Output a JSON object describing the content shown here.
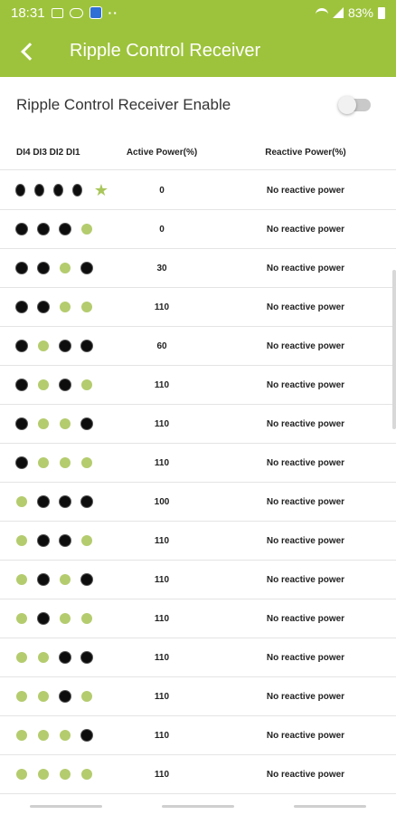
{
  "status_bar": {
    "time": "18:31",
    "dots": "··",
    "battery_text": "83%",
    "icons": [
      "image-icon",
      "wifi-icon",
      "app-icon",
      "wifi-signal-icon",
      "cell-signal-icon",
      "battery-icon"
    ]
  },
  "app_bar": {
    "back_icon": "chevron-left-icon",
    "title": "Ripple Control Receiver"
  },
  "enable": {
    "label": "Ripple Control Receiver Enable",
    "toggle_on": false
  },
  "table": {
    "headers": {
      "di": "DI4 DI3 DI2 DI1",
      "active": "Active Power(%)",
      "reactive": "Reactive Power(%)"
    },
    "rows": [
      {
        "di": [
          "on",
          "on",
          "on",
          "on"
        ],
        "starred": true,
        "active": "0",
        "reactive": "No reactive power"
      },
      {
        "di": [
          "on",
          "on",
          "on",
          "off"
        ],
        "starred": false,
        "active": "0",
        "reactive": "No reactive power"
      },
      {
        "di": [
          "on",
          "on",
          "off",
          "on"
        ],
        "starred": false,
        "active": "30",
        "reactive": "No reactive power"
      },
      {
        "di": [
          "on",
          "on",
          "off",
          "off"
        ],
        "starred": false,
        "active": "110",
        "reactive": "No reactive power"
      },
      {
        "di": [
          "on",
          "off",
          "on",
          "on"
        ],
        "starred": false,
        "active": "60",
        "reactive": "No reactive power"
      },
      {
        "di": [
          "on",
          "off",
          "on",
          "off"
        ],
        "starred": false,
        "active": "110",
        "reactive": "No reactive power"
      },
      {
        "di": [
          "on",
          "off",
          "off",
          "on"
        ],
        "starred": false,
        "active": "110",
        "reactive": "No reactive power"
      },
      {
        "di": [
          "on",
          "off",
          "off",
          "off"
        ],
        "starred": false,
        "active": "110",
        "reactive": "No reactive power"
      },
      {
        "di": [
          "off",
          "on",
          "on",
          "on"
        ],
        "starred": false,
        "active": "100",
        "reactive": "No reactive power"
      },
      {
        "di": [
          "off",
          "on",
          "on",
          "off"
        ],
        "starred": false,
        "active": "110",
        "reactive": "No reactive power"
      },
      {
        "di": [
          "off",
          "on",
          "off",
          "on"
        ],
        "starred": false,
        "active": "110",
        "reactive": "No reactive power"
      },
      {
        "di": [
          "off",
          "on",
          "off",
          "off"
        ],
        "starred": false,
        "active": "110",
        "reactive": "No reactive power"
      },
      {
        "di": [
          "off",
          "off",
          "on",
          "on"
        ],
        "starred": false,
        "active": "110",
        "reactive": "No reactive power"
      },
      {
        "di": [
          "off",
          "off",
          "on",
          "off"
        ],
        "starred": false,
        "active": "110",
        "reactive": "No reactive power"
      },
      {
        "di": [
          "off",
          "off",
          "off",
          "on"
        ],
        "starred": false,
        "active": "110",
        "reactive": "No reactive power"
      },
      {
        "di": [
          "off",
          "off",
          "off",
          "off"
        ],
        "starred": false,
        "active": "110",
        "reactive": "No reactive power"
      }
    ]
  },
  "colors": {
    "accent": "#9dc33c",
    "dot_on": "#0d0d0d",
    "dot_off": "#b4cc6e",
    "star": "#a9c65a"
  }
}
